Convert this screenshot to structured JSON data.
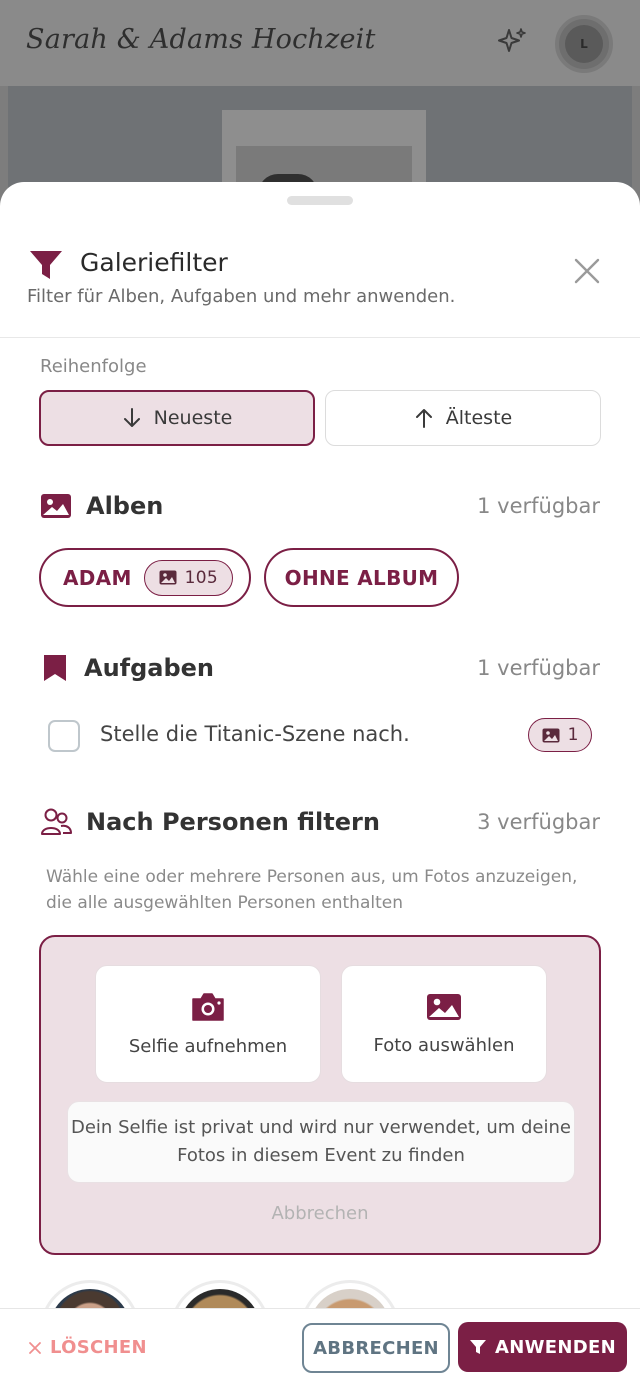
{
  "app": {
    "title": "Sarah & Adams Hochzeit",
    "avatar_initial": "L"
  },
  "sheet": {
    "title": "Galeriefilter",
    "subtitle": "Filter für Alben, Aufgaben und mehr anwenden."
  },
  "order": {
    "label": "Reihenfolge",
    "newest": "Neueste",
    "oldest": "Älteste",
    "selected": "newest"
  },
  "albums": {
    "title": "Alben",
    "available": "1 verfügbar",
    "items": [
      {
        "label": "ADAM",
        "count": "105"
      },
      {
        "label": "OHNE ALBUM"
      }
    ]
  },
  "tasks": {
    "title": "Aufgaben",
    "available": "1 verfügbar",
    "items": [
      {
        "label": "Stelle die Titanic-Szene nach.",
        "count": "1",
        "checked": false
      }
    ]
  },
  "persons": {
    "title": "Nach Personen filtern",
    "available": "3 verfügbar",
    "description": "Wähle eine oder mehrere Personen aus, um Fotos anzuzeigen, die alle ausgewählten Personen enthalten",
    "selfie_label": "Selfie aufnehmen",
    "photo_label": "Foto auswählen",
    "privacy_note": "Dein Selfie ist privat und wird nur verwendet, um deine Fotos in diesem Event zu finden",
    "cancel_label": "Abbrechen"
  },
  "footer": {
    "clear": "LÖSCHEN",
    "cancel": "ABBRECHEN",
    "apply": "ANWENDEN"
  },
  "colors": {
    "accent": "#7b1f45",
    "accent_light": "#eddfe4",
    "clear": "#f08f8f",
    "secondary": "#6f8594"
  }
}
